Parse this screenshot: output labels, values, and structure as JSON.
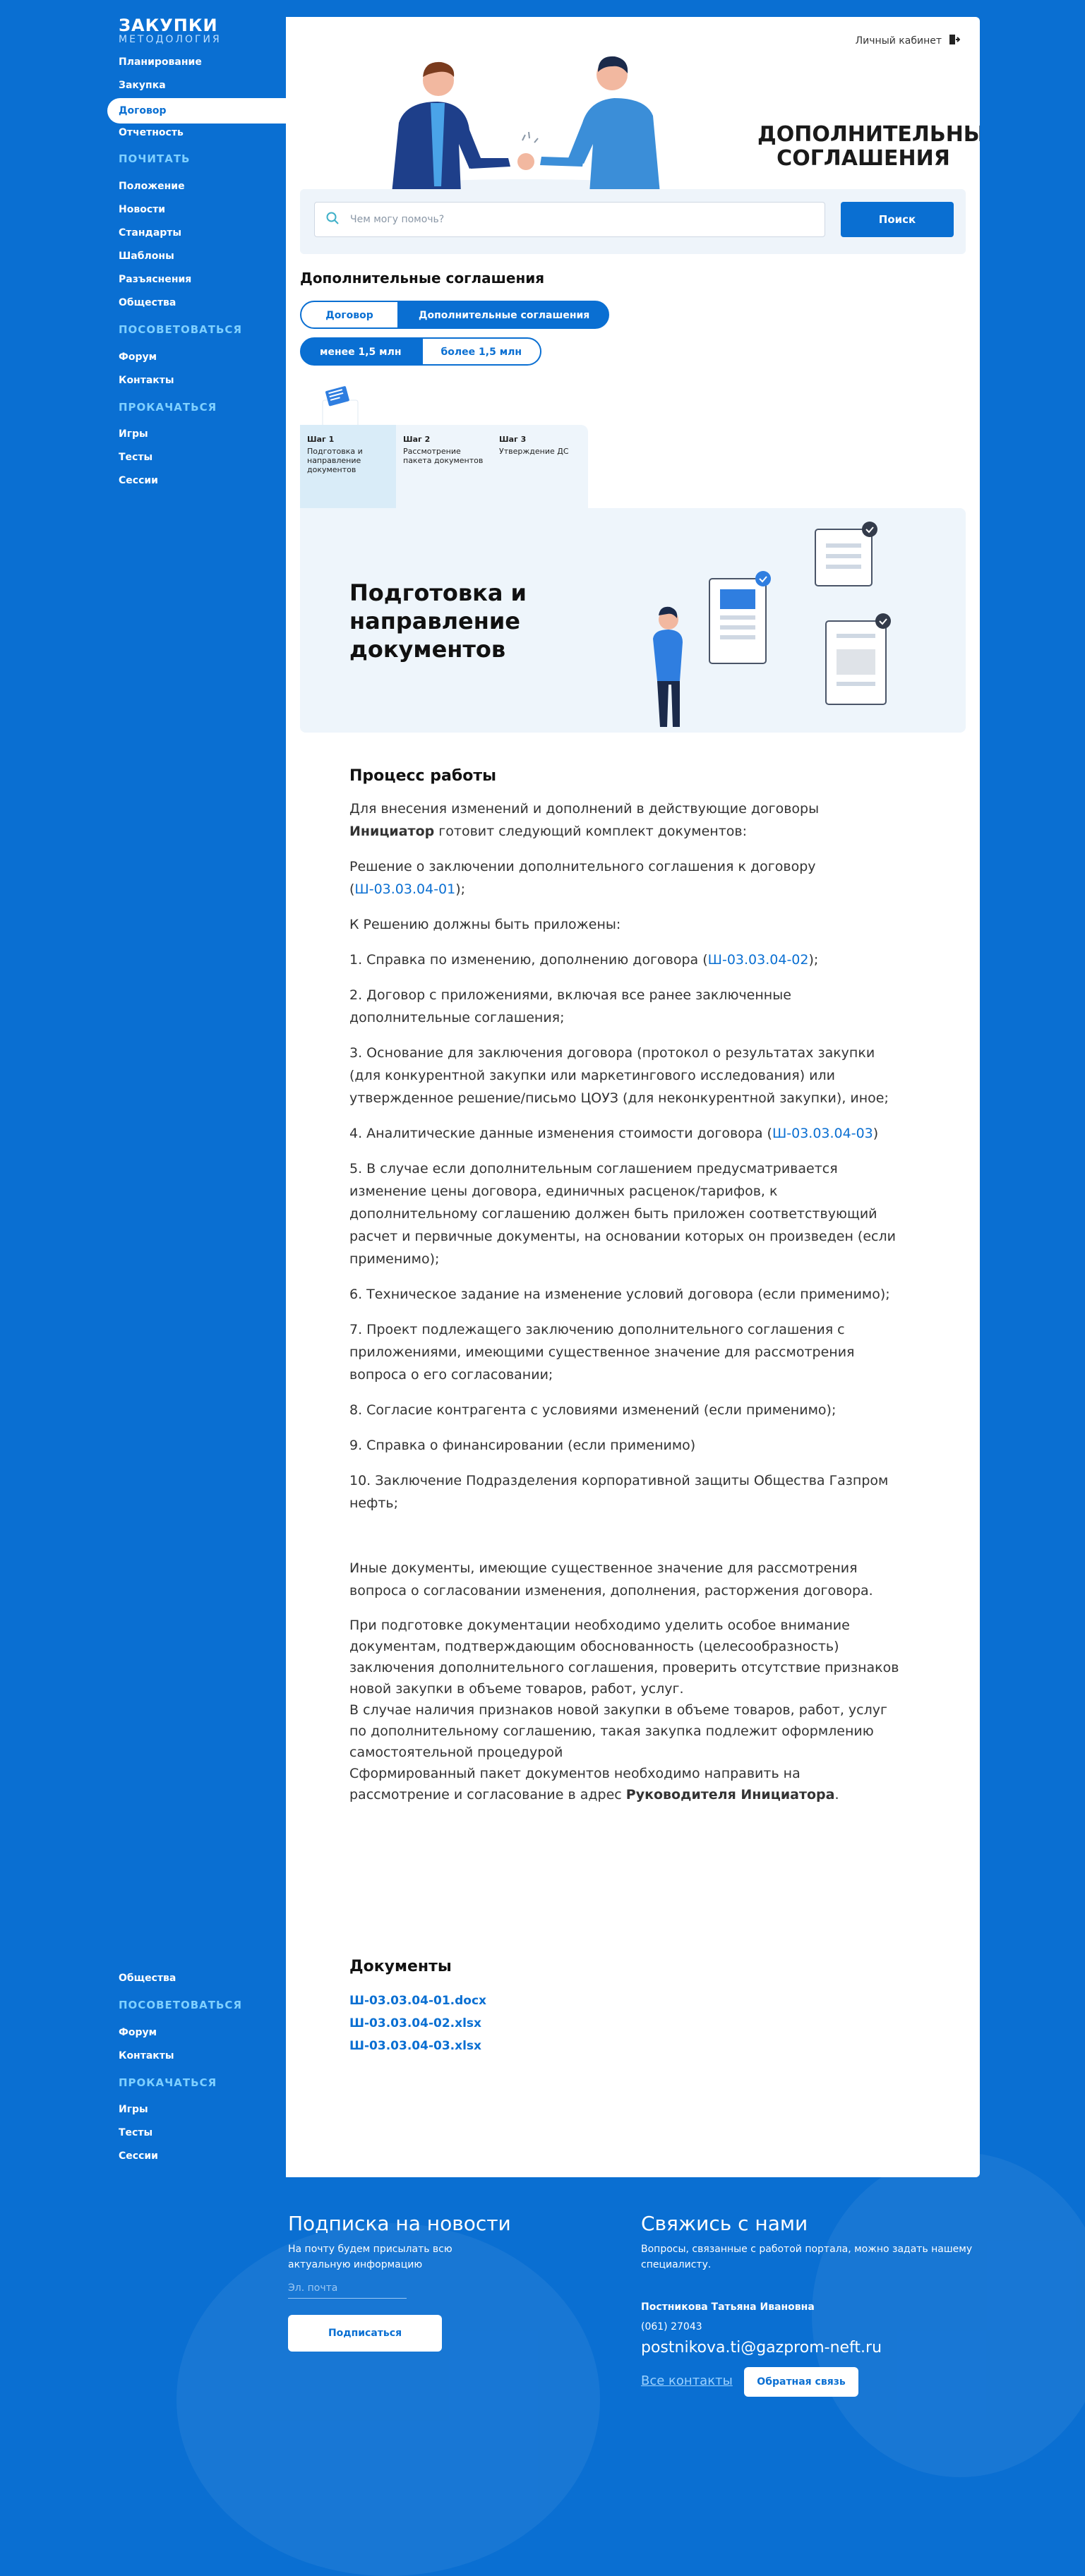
{
  "logo": {
    "title": "ЗАКУПКИ",
    "subtitle": "МЕТОДОЛОГИЯ"
  },
  "sidebar": {
    "top_items": [
      {
        "label": "Планирование"
      },
      {
        "label": "Закупка"
      },
      {
        "label": "Договор"
      },
      {
        "label": "Отчетность"
      }
    ],
    "group1": "ПОЧИТАТЬ",
    "group1_items": [
      {
        "label": "Положение"
      },
      {
        "label": "Новости"
      },
      {
        "label": "Стандарты"
      },
      {
        "label": "Шаблоны"
      },
      {
        "label": "Разъяснения"
      },
      {
        "label": "Общества"
      }
    ],
    "group2": "ПОСОВЕТОВАТЬСЯ",
    "group2_items": [
      {
        "label": "Форум"
      },
      {
        "label": "Контакты"
      }
    ],
    "group3": "ПРОКАЧАТЬСЯ",
    "group3_items": [
      {
        "label": "Игры"
      },
      {
        "label": "Тесты"
      },
      {
        "label": "Сессии"
      }
    ]
  },
  "sidebar_bottom": {
    "item_top": "Общества",
    "group2": "ПОСОВЕТОВАТЬСЯ",
    "group2_items": [
      {
        "label": "Форум"
      },
      {
        "label": "Контакты"
      }
    ],
    "group3": "ПРОКАЧАТЬСЯ",
    "group3_items": [
      {
        "label": "Игры"
      },
      {
        "label": "Тесты"
      },
      {
        "label": "Сессии"
      }
    ]
  },
  "header": {
    "cabinet": "Личный кабинет",
    "hero_title": "ДОПОЛНИТЕЛЬНЫЕ СОГЛАШЕНИЯ"
  },
  "search": {
    "placeholder": "Чем могу помочь?",
    "button": "Поиск"
  },
  "section": {
    "title": "Дополнительные соглашения"
  },
  "tabs": {
    "contract": "Договор",
    "addenda": "Дополнительные соглашения"
  },
  "amount_tabs": {
    "less": "менее 1,5 млн",
    "more": "более 1,5 млн"
  },
  "steps": [
    {
      "num": "Шаг 1",
      "text": "Подготовка и направление документов"
    },
    {
      "num": "Шаг 2",
      "text": "Рассмотрение пакета документов"
    },
    {
      "num": "Шаг 3",
      "text": "Утверждение ДС"
    }
  ],
  "banner": {
    "title": "Подготовка и направление документов"
  },
  "content": {
    "heading": "Процесс работы",
    "p1_a": "Для внесения изменений и дополнений  в действующие договоры ",
    "p1_b": "Инициатор",
    "p1_c": " готовит следующий комплект документов:",
    "p2_a": "Решение о заключении дополнительного соглашения к договору (",
    "p2_link": "Ш-03.03.04-01",
    "p2_b": ");",
    "p3": "К Решению должны быть приложены:",
    "i1_a": "1. Справка по изменению, дополнению договора (",
    "i1_link": "Ш-03.03.04-02",
    "i1_b": ");",
    "i2": "2. Договор с приложениями, включая все ранее заключенные дополнительные соглашения;",
    "i3": "3. Основание для заключения договора (протокол о результатах закупки (для конкурентной закупки или маркетингового исследования) или утвержденное решение/письмо ЦОУЗ (для неконкурентной закупки), иное;",
    "i4_a": "4. Аналитические данные изменения стоимости договора (",
    "i4_link": "Ш-03.03.04-03",
    "i4_b": ")",
    "i5": "5. В случае если дополнительным соглашением предусматривается изменение цены договора, единичных расценок/тарифов, к дополнительному соглашению должен быть приложен соответствующий расчет и первичные документы, на основании которых он произведен (если применимо);",
    "i6": "6. Техническое задание на изменение условий договора (если применимо);",
    "i7": "7. Проект подлежащего заключению дополнительного соглашения с приложениями, имеющими существенное значение для рассмотрения вопроса о его согласовании;",
    "i8": "8. Согласие контрагента с условиями изменений (если применимо);",
    "i9": "9. Справка о финансировании (если применимо)",
    "i10": "10. Заключение Подразделения корпоративной защиты Общества Газпром нефть;",
    "p4": "Иные документы, имеющие существенное значение для рассмотрения вопроса о согласовании изменения, дополнения, расторжения договора.",
    "p5_1": "При подготовке документации необходимо уделить особое внимание документам, подтверждающим обоснованность (целесообразность) заключения дополнительного соглашения, проверить отсутствие признаков новой закупки в объеме товаров, работ, услуг.",
    "p5_2": "В случае наличия признаков новой закупки в объеме товаров, работ, услуг по дополнительному соглашению, такая закупка подлежит оформлению самостоятельной процедурой",
    "p5_3": "Сформированный пакет документов необходимо направить на рассмотрение и согласование в адрес ",
    "p5_bold": "Руководителя Инициатора",
    "p5_end": "."
  },
  "docs": {
    "heading": "Документы",
    "files": [
      "Ш-03.03.04-01.docx",
      "Ш-03.03.04-02.xlsx",
      "Ш-03.03.04-03.xlsx"
    ]
  },
  "footer": {
    "sub_title": "Подписка на новости",
    "sub_text": "На почту будем присылать всю актуальную информацию",
    "email_placeholder": "Эл. почта",
    "sub_button": "Подписаться",
    "contact_title": "Свяжись с нами",
    "contact_text": "Вопросы, связанные с работой портала, можно задать нашему специалисту.",
    "person": "Постникова Татьяна Ивановна",
    "phone": "(061) 27043",
    "email": "postnikova.ti@gazprom-neft.ru",
    "all_contacts": "Все контакты",
    "feedback_button": "Обратная связь"
  },
  "colors": {
    "primary": "#0a6fd2",
    "accent_light": "#7fd0ff",
    "banner_bg": "#eef5fb"
  }
}
